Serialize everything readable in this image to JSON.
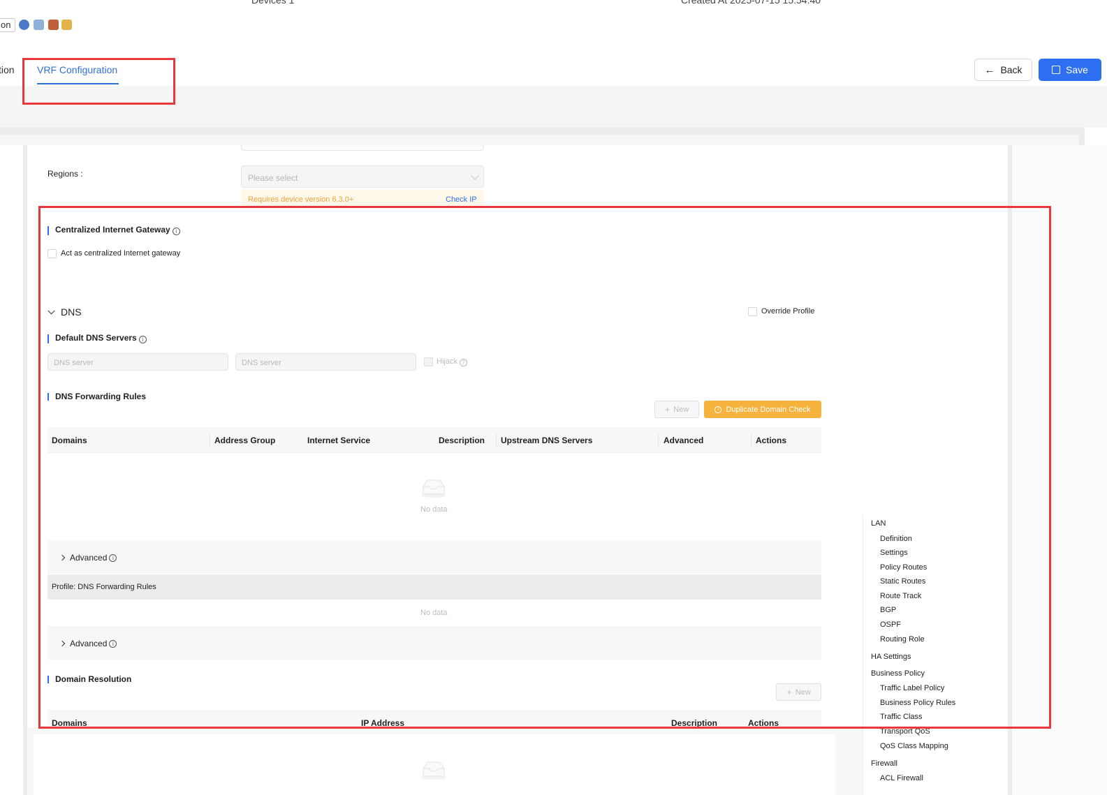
{
  "top": {
    "cut_left": "Devices  1",
    "cut_right": "Created At  2025-07-15 15:54:40",
    "chip_label": "on"
  },
  "tabs": {
    "prev_label": "tion",
    "active_label": "VRF Configuration"
  },
  "actions": {
    "back_label": "Back",
    "save_label": "Save"
  },
  "regions": {
    "label": "Regions :",
    "placeholder": "Please select",
    "requirement": "Requires device version 6.3.0+",
    "check_ip": "Check IP"
  },
  "gateway": {
    "title": "Centralized Internet Gateway",
    "checkbox_label": "Act as centralized Internet gateway"
  },
  "dns": {
    "title": "DNS",
    "override_label": "Override Profile",
    "default_servers_title": "Default DNS Servers",
    "server1_placeholder": "DNS server",
    "server2_placeholder": "DNS server",
    "hijack_label": "Hijack"
  },
  "forwarding": {
    "title": "DNS Forwarding Rules",
    "new_label": "New",
    "dup_label": "Duplicate Domain Check",
    "columns": [
      "Domains",
      "Address Group",
      "Internet Service",
      "Description",
      "Upstream DNS Servers",
      "Advanced",
      "Actions"
    ],
    "empty_text": "No data",
    "advanced_label": "Advanced",
    "profile_label": "Profile: DNS Forwarding Rules",
    "profile_empty": "No data",
    "advanced2_label": "Advanced"
  },
  "resolution": {
    "title": "Domain Resolution",
    "new_label": "New",
    "columns": [
      "Domains",
      "IP Address",
      "Description",
      "Actions"
    ]
  },
  "sidenav": {
    "groups": [
      {
        "label": "LAN",
        "items": [
          "Definition",
          "Settings",
          "Policy Routes",
          "Static Routes",
          "Route Track",
          "BGP",
          "OSPF",
          "Routing Role"
        ]
      },
      {
        "label": "HA Settings",
        "items": []
      },
      {
        "label": "Business Policy",
        "items": [
          "Traffic Label Policy",
          "Business Policy Rules",
          "Traffic Class",
          "Transport QoS",
          "QoS Class Mapping"
        ]
      },
      {
        "label": "Firewall",
        "items": [
          "ACL Firewall"
        ]
      }
    ]
  },
  "colors": {
    "accent": "#2f6fe0",
    "save": "#2d6ff0",
    "warning": "#f5b33d",
    "highlight": "#e8383d"
  }
}
